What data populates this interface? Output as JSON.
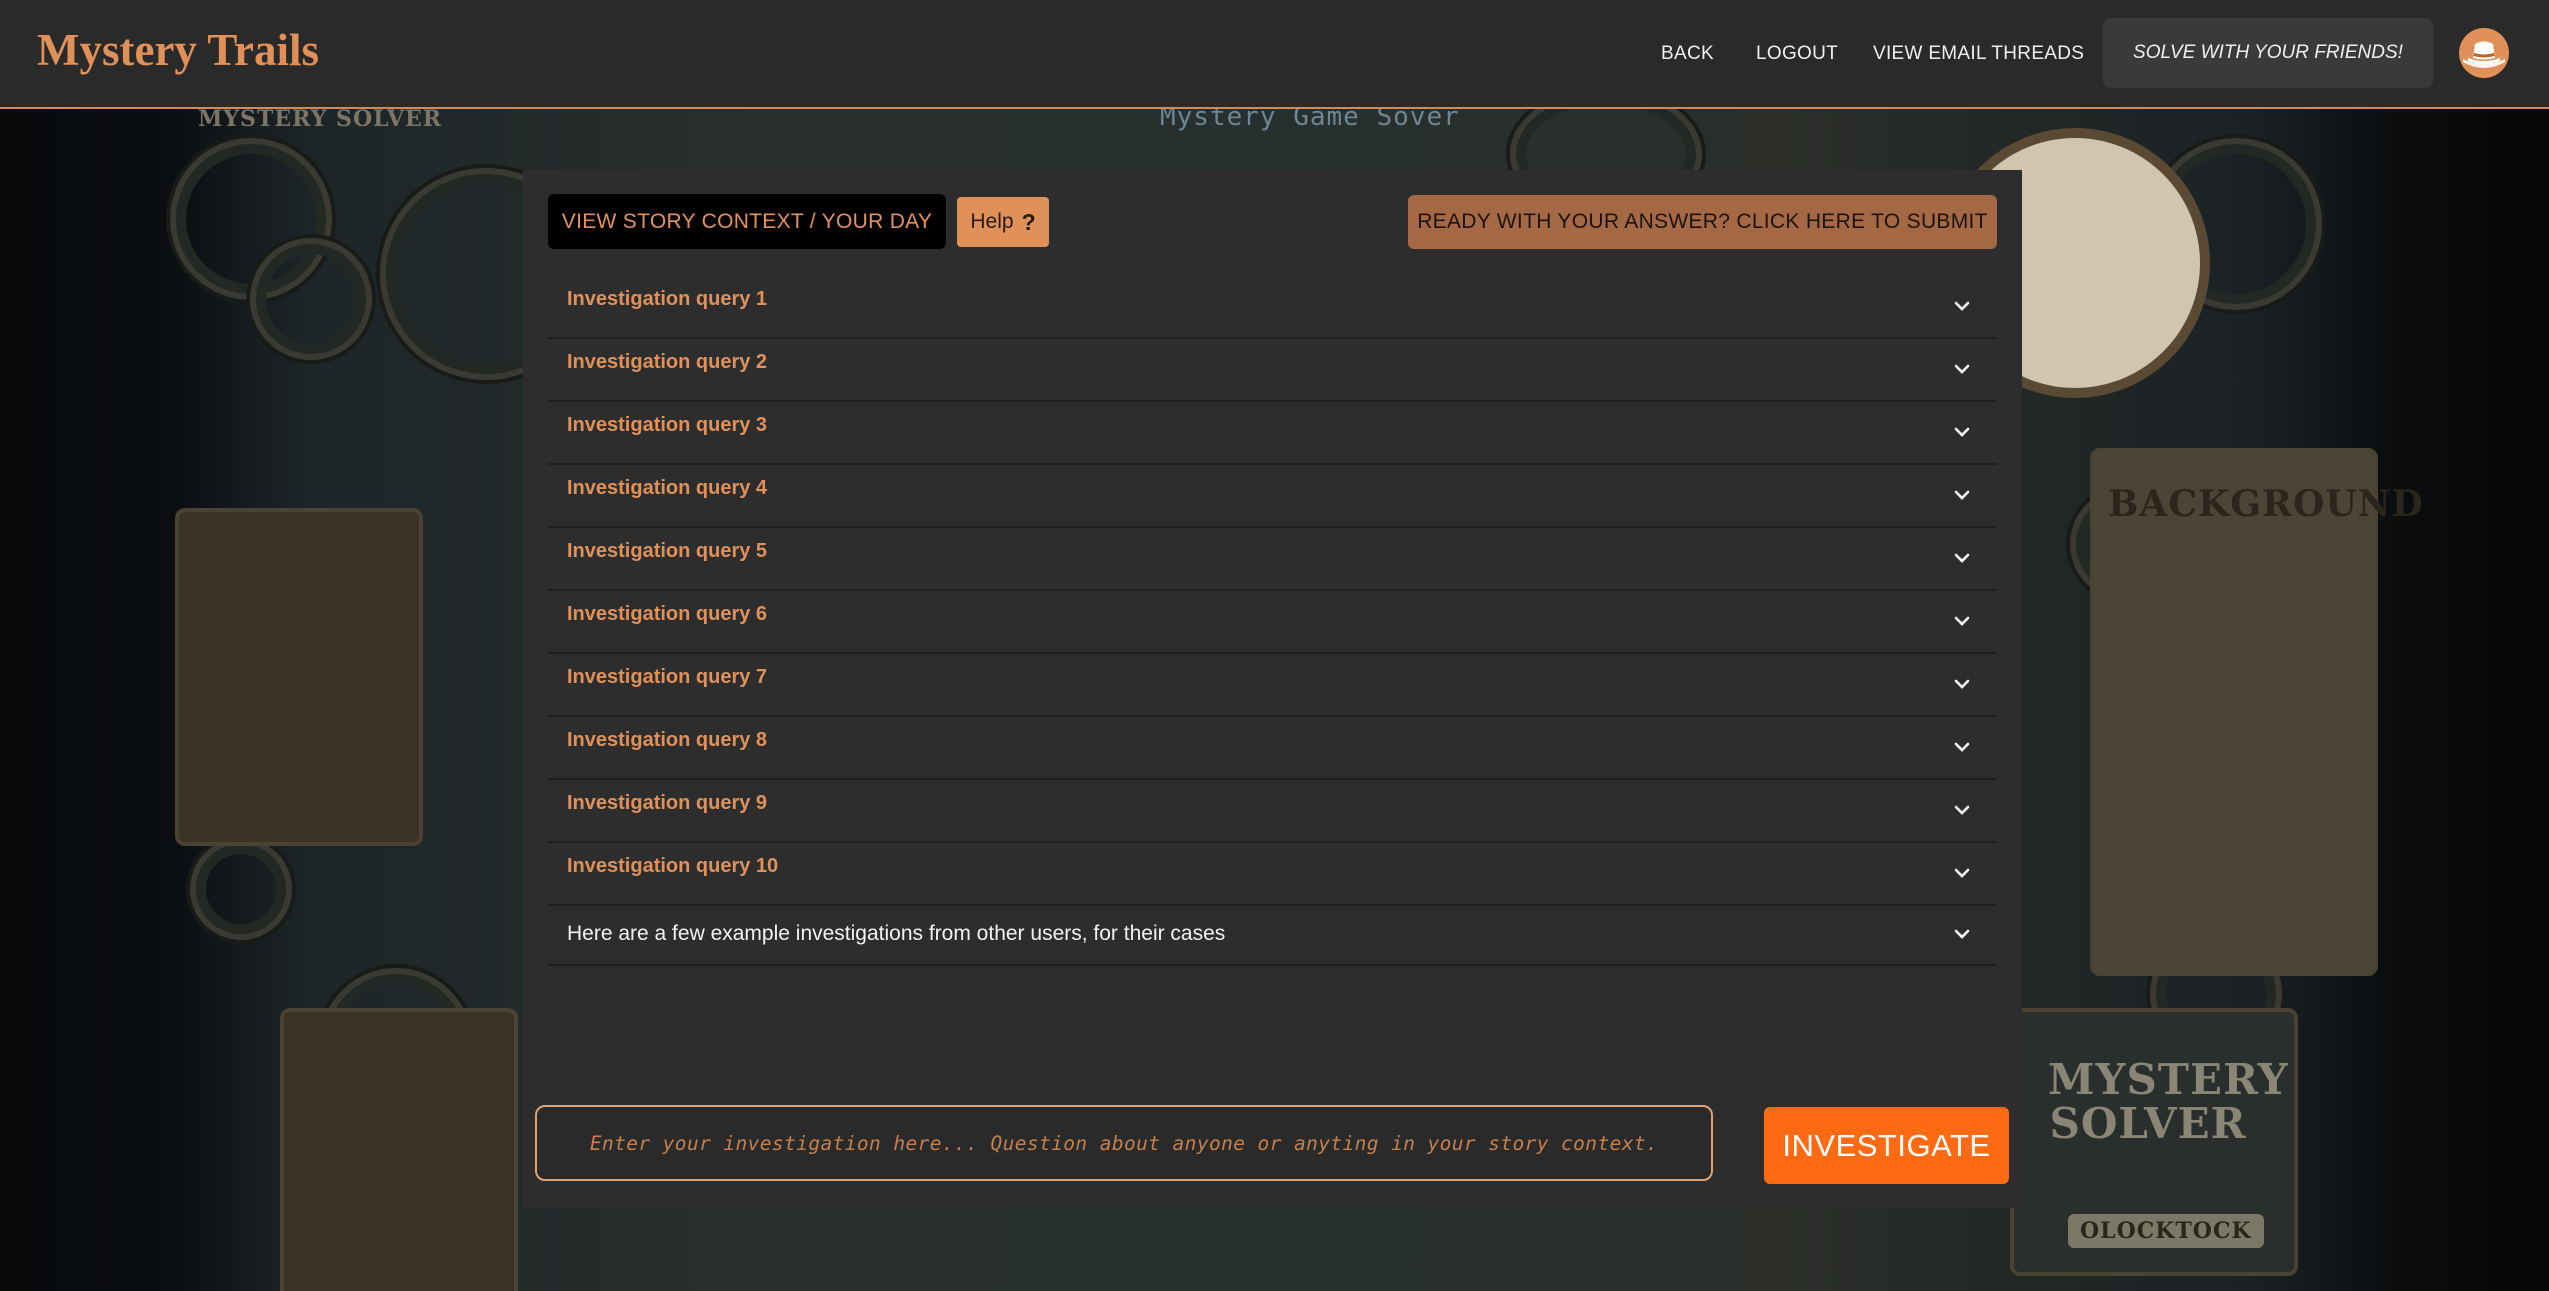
{
  "header": {
    "brand": "Mystery Trails",
    "nav": {
      "back": "BACK",
      "logout": "LOGOUT",
      "email_threads": "VIEW EMAIL THREADS",
      "friends": "SOLVE WITH YOUR FRIENDS!"
    },
    "avatar_icon": "detective-hat-icon"
  },
  "background": {
    "top_banner": "Mystery Game Sover",
    "left_sign": "MYSTERY SOLVER",
    "right_sign_title": "BACKGROUND",
    "right_bottom_sign": "MYSTERY SOLVER",
    "right_bottom_tag": "OLOCKTOCK"
  },
  "toolbar": {
    "story_context": "VIEW STORY CONTEXT / YOUR DAY",
    "help": "Help",
    "help_icon": "?",
    "submit": "READY WITH YOUR ANSWER? CLICK HERE TO SUBMIT"
  },
  "queries": [
    "Investigation query 1",
    "Investigation query 2",
    "Investigation query 3",
    "Investigation query 4",
    "Investigation query 5",
    "Investigation query 6",
    "Investigation query 7",
    "Investigation query 8",
    "Investigation query 9",
    "Investigation query 10"
  ],
  "examples_label": "Here are a few example investigations from other users, for their cases",
  "input": {
    "placeholder": "Enter your investigation here... Question about anyone or anyting in your story context.",
    "value": ""
  },
  "investigate_button": "INVESTIGATE",
  "colors": {
    "accent": "#e0915a",
    "investigate": "#ff6a12",
    "submit": "#a56845",
    "panel": "#2d2d2d",
    "header": "#2a2a2a"
  }
}
